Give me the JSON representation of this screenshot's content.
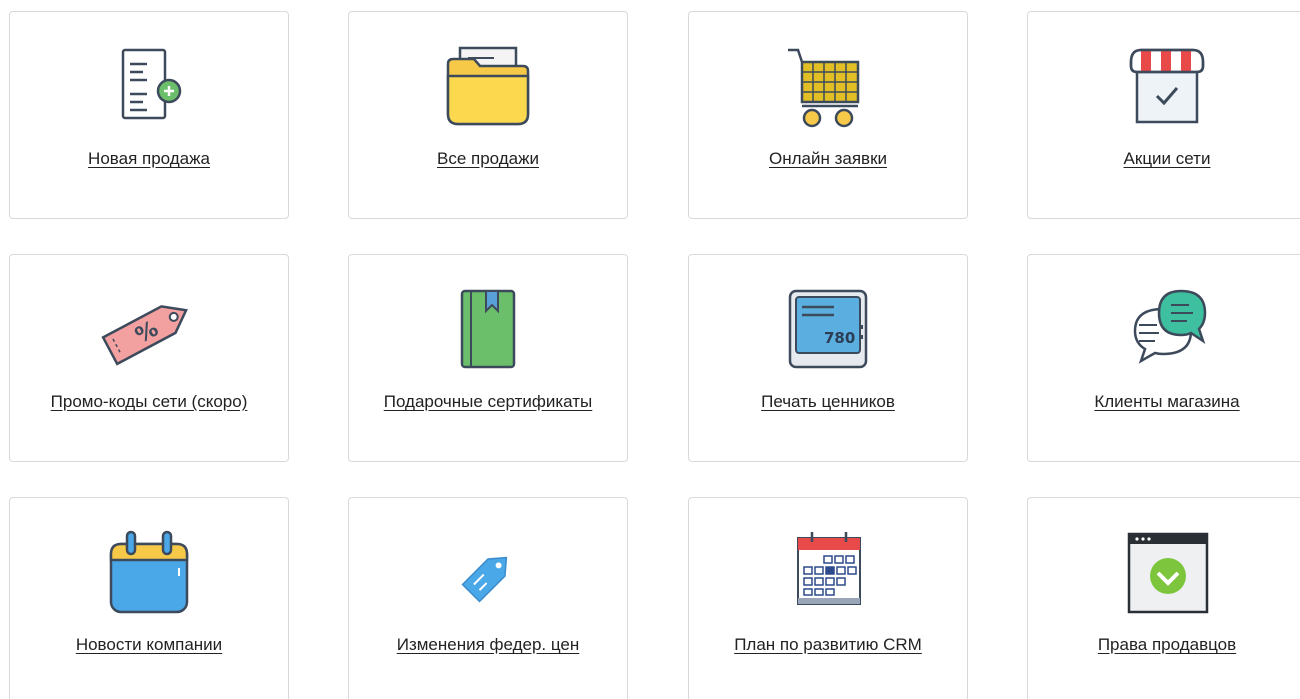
{
  "tiles": [
    {
      "label": "Новая продажа",
      "icon": "document-add-icon"
    },
    {
      "label": "Все продажи",
      "icon": "folder-icon"
    },
    {
      "label": "Онлайн заявки",
      "icon": "shopping-cart-icon"
    },
    {
      "label": "Акции сети",
      "icon": "store-check-icon"
    },
    {
      "label": "Промо-коды сети (скоро)",
      "icon": "discount-tag-icon"
    },
    {
      "label": "Подарочные сертификаты",
      "icon": "green-book-icon"
    },
    {
      "label": "Печать ценников",
      "icon": "price-display-icon"
    },
    {
      "label": "Клиенты магазина",
      "icon": "chat-bubbles-icon"
    },
    {
      "label": "Новости компании",
      "icon": "calendar-icon"
    },
    {
      "label": "Изменения федер. цен",
      "icon": "blue-tag-icon"
    },
    {
      "label": "План по развитию CRM",
      "icon": "calendar-grid-icon"
    },
    {
      "label": "Права продавцов",
      "icon": "browser-check-icon"
    }
  ],
  "icon_texts": {
    "price_display": "780"
  },
  "colors": {
    "tile_border": "#d9d9d9",
    "label_text": "#222222"
  }
}
